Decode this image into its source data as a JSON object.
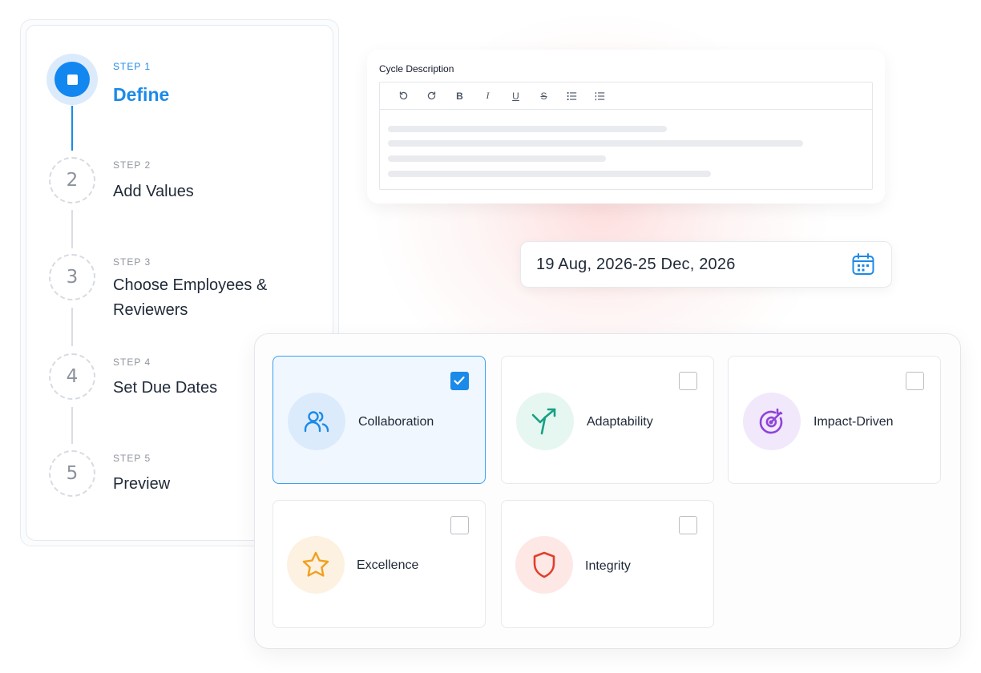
{
  "stepper": {
    "steps": [
      {
        "label": "STEP 1",
        "title": "Define",
        "number": "",
        "status": "active"
      },
      {
        "label": "STEP 2",
        "title": "Add Values",
        "number": "2",
        "status": "pending"
      },
      {
        "label": "STEP 3",
        "title": "Choose Employees & Reviewers",
        "number": "3",
        "status": "pending"
      },
      {
        "label": "STEP 4",
        "title": "Set Due Dates",
        "number": "4",
        "status": "pending"
      },
      {
        "label": "STEP 5",
        "title": "Preview",
        "number": "5",
        "status": "pending"
      }
    ]
  },
  "editor": {
    "title": "Cycle Description",
    "toolbar": [
      "undo",
      "redo",
      "bold",
      "italic",
      "underline",
      "strikethrough",
      "bullet-list",
      "numbered-list"
    ],
    "toolbar_glyphs": {
      "bold": "B",
      "italic": "I",
      "underline": "U",
      "strikethrough": "S"
    }
  },
  "date_range": {
    "value": "19 Aug, 2026-25 Dec, 2026",
    "icon": "calendar-icon"
  },
  "values": [
    {
      "label": "Collaboration",
      "icon": "users-icon",
      "checked": true,
      "color": "#1b8ae8",
      "bg": "#dcebfb"
    },
    {
      "label": "Adaptability",
      "icon": "split-arrow-icon",
      "checked": false,
      "color": "#16a085",
      "bg": "#e6f6f0"
    },
    {
      "label": "Impact-Driven",
      "icon": "target-icon",
      "checked": false,
      "color": "#8e44d9",
      "bg": "#f1e8fb"
    },
    {
      "label": "Excellence",
      "icon": "star-icon",
      "checked": false,
      "color": "#f0a020",
      "bg": "#fdf1e1"
    },
    {
      "label": "Integrity",
      "icon": "shield-icon",
      "checked": false,
      "color": "#e0402c",
      "bg": "#fde8e5"
    }
  ],
  "colors": {
    "accent": "#1b8ae8",
    "selected_border": "#3ba0f0"
  }
}
